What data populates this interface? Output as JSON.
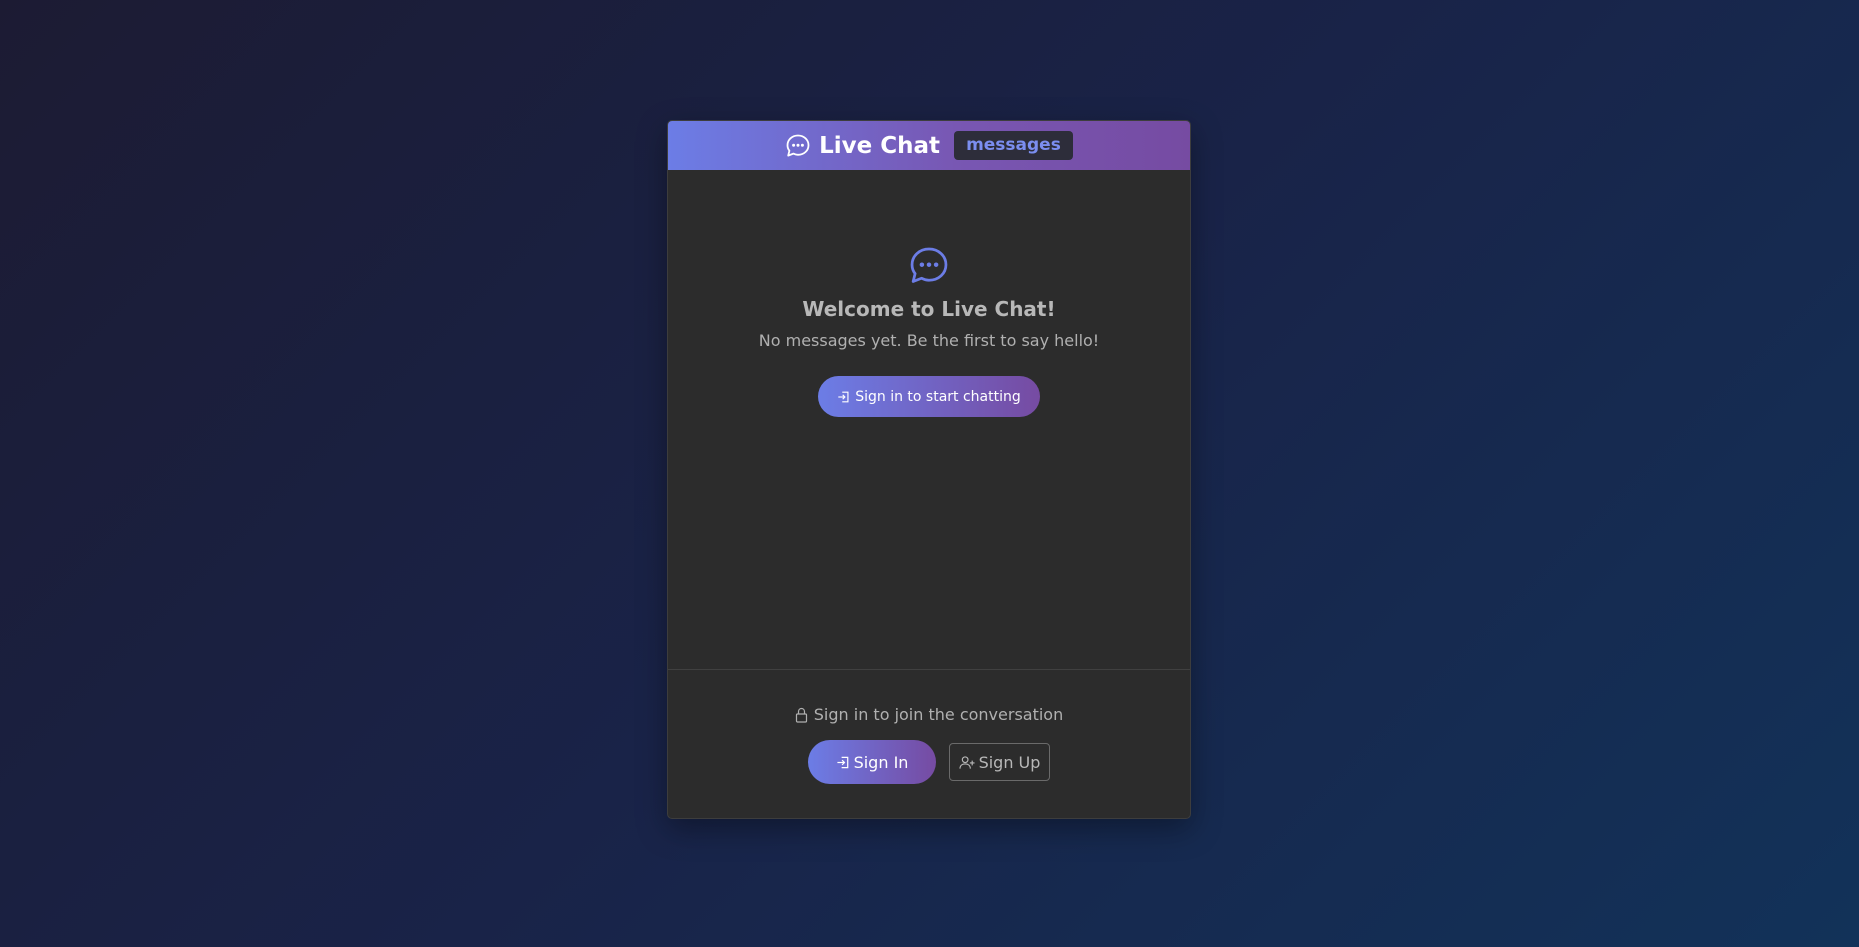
{
  "header": {
    "title": "Live Chat",
    "badge": "messages",
    "icon": "chat-dots-icon"
  },
  "welcome": {
    "icon": "chat-dots-icon",
    "title": "Welcome to Live Chat!",
    "subtitle": "No messages yet. Be the first to say hello!",
    "cta_label": "Sign in to start chatting",
    "cta_icon": "sign-in-icon"
  },
  "footer": {
    "note": "Sign in to join the conversation",
    "note_icon": "lock-icon",
    "signin_label": "Sign In",
    "signin_icon": "sign-in-icon",
    "signup_label": "Sign Up",
    "signup_icon": "person-plus-icon"
  },
  "colors": {
    "accent_start": "#6c7de6",
    "accent_end": "#764ba2",
    "card_bg": "#2c2c2c",
    "badge_text": "#7b8ef0"
  }
}
